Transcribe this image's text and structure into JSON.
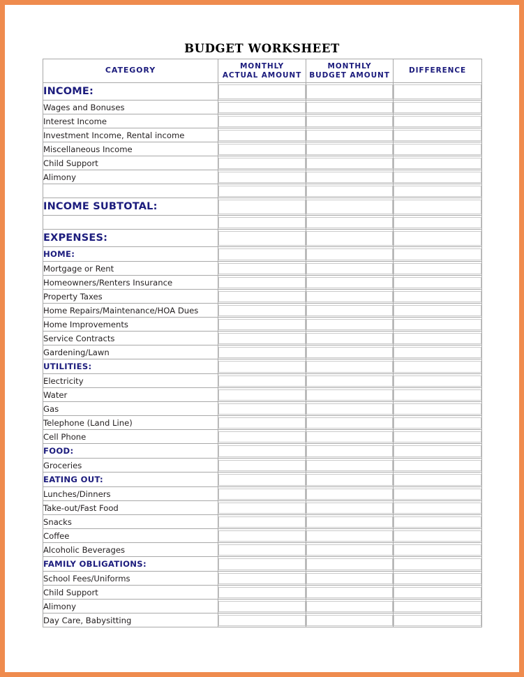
{
  "page": {
    "frame_color": "#ef8b4e",
    "background": "#ffffff",
    "title": "BUDGET WORKSHEET",
    "heading_color": "#1c1c7d",
    "text_color": "#231f20"
  },
  "table": {
    "columns": [
      {
        "key": "category",
        "label": "CATEGORY"
      },
      {
        "key": "actual",
        "label": "MONTHLY ACTUAL AMOUNT",
        "line1": "MONTHLY",
        "line2": "ACTUAL AMOUNT"
      },
      {
        "key": "budget",
        "label": "MONTHLY BUDGET AMOUNT",
        "line1": "MONTHLY",
        "line2": "BUDGET AMOUNT"
      },
      {
        "key": "difference",
        "label": "DIFFERENCE",
        "line1": "DIFFERENCE",
        "line2": ""
      }
    ],
    "rows": [
      {
        "type": "major",
        "label": "INCOME:",
        "actual": "",
        "budget": "",
        "difference": ""
      },
      {
        "type": "item",
        "label": "Wages and Bonuses",
        "actual": "",
        "budget": "",
        "difference": ""
      },
      {
        "type": "item",
        "label": "Interest Income",
        "actual": "",
        "budget": "",
        "difference": ""
      },
      {
        "type": "item",
        "label": "Investment Income, Rental income",
        "actual": "",
        "budget": "",
        "difference": ""
      },
      {
        "type": "item",
        "label": "Miscellaneous Income",
        "actual": "",
        "budget": "",
        "difference": ""
      },
      {
        "type": "item",
        "label": "Child Support",
        "actual": "",
        "budget": "",
        "difference": ""
      },
      {
        "type": "item",
        "label": "Alimony",
        "actual": "",
        "budget": "",
        "difference": ""
      },
      {
        "type": "blank",
        "label": "",
        "actual": "",
        "budget": "",
        "difference": ""
      },
      {
        "type": "major",
        "label": "INCOME SUBTOTAL:",
        "actual": "",
        "budget": "",
        "difference": ""
      },
      {
        "type": "blank",
        "label": "",
        "actual": "",
        "budget": "",
        "difference": ""
      },
      {
        "type": "major",
        "label": "EXPENSES:",
        "actual": "",
        "budget": "",
        "difference": ""
      },
      {
        "type": "sub",
        "label": "HOME:",
        "actual": "",
        "budget": "",
        "difference": ""
      },
      {
        "type": "item",
        "label": "Mortgage or Rent",
        "actual": "",
        "budget": "",
        "difference": ""
      },
      {
        "type": "item",
        "label": "Homeowners/Renters Insurance",
        "actual": "",
        "budget": "",
        "difference": ""
      },
      {
        "type": "item",
        "label": "Property Taxes",
        "actual": "",
        "budget": "",
        "difference": ""
      },
      {
        "type": "item",
        "label": "Home Repairs/Maintenance/HOA Dues",
        "actual": "",
        "budget": "",
        "difference": ""
      },
      {
        "type": "item",
        "label": "Home Improvements",
        "actual": "",
        "budget": "",
        "difference": ""
      },
      {
        "type": "item",
        "label": "Service Contracts",
        "actual": "",
        "budget": "",
        "difference": ""
      },
      {
        "type": "item",
        "label": "Gardening/Lawn",
        "actual": "",
        "budget": "",
        "difference": ""
      },
      {
        "type": "sub",
        "label": "UTILITIES:",
        "actual": "",
        "budget": "",
        "difference": ""
      },
      {
        "type": "item",
        "label": "Electricity",
        "actual": "",
        "budget": "",
        "difference": ""
      },
      {
        "type": "item",
        "label": "Water",
        "actual": "",
        "budget": "",
        "difference": ""
      },
      {
        "type": "item",
        "label": "Gas",
        "actual": "",
        "budget": "",
        "difference": ""
      },
      {
        "type": "item",
        "label": "Telephone (Land Line)",
        "actual": "",
        "budget": "",
        "difference": ""
      },
      {
        "type": "item",
        "label": "Cell Phone",
        "actual": "",
        "budget": "",
        "difference": ""
      },
      {
        "type": "sub",
        "label": "FOOD:",
        "actual": "",
        "budget": "",
        "difference": ""
      },
      {
        "type": "item",
        "label": "Groceries",
        "actual": "",
        "budget": "",
        "difference": ""
      },
      {
        "type": "sub",
        "label": "EATING OUT:",
        "actual": "",
        "budget": "",
        "difference": ""
      },
      {
        "type": "item",
        "label": "Lunches/Dinners",
        "actual": "",
        "budget": "",
        "difference": ""
      },
      {
        "type": "item",
        "label": "Take-out/Fast Food",
        "actual": "",
        "budget": "",
        "difference": ""
      },
      {
        "type": "item",
        "label": "Snacks",
        "actual": "",
        "budget": "",
        "difference": ""
      },
      {
        "type": "item",
        "label": "Coffee",
        "actual": "",
        "budget": "",
        "difference": ""
      },
      {
        "type": "item",
        "label": "Alcoholic Beverages",
        "actual": "",
        "budget": "",
        "difference": ""
      },
      {
        "type": "sub",
        "label": "FAMILY OBLIGATIONS:",
        "actual": "",
        "budget": "",
        "difference": ""
      },
      {
        "type": "item",
        "label": "School Fees/Uniforms",
        "actual": "",
        "budget": "",
        "difference": ""
      },
      {
        "type": "item",
        "label": "Child Support",
        "actual": "",
        "budget": "",
        "difference": ""
      },
      {
        "type": "item",
        "label": "Alimony",
        "actual": "",
        "budget": "",
        "difference": ""
      },
      {
        "type": "item",
        "label": "Day Care, Babysitting",
        "actual": "",
        "budget": "",
        "difference": ""
      }
    ]
  }
}
